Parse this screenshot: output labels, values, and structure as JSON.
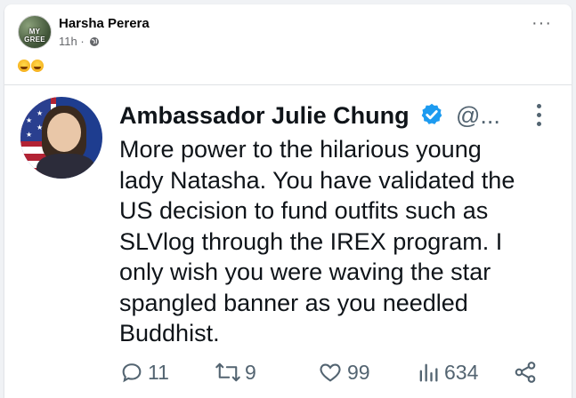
{
  "post": {
    "author": "Harsha Perera",
    "avatar_text": "MY GREE",
    "time": "11h ·",
    "reactions": [
      "rolling-on-floor-laughing",
      "rolling-on-floor-laughing"
    ]
  },
  "tweet": {
    "name": "Ambassador Julie Chung",
    "handle": "@...",
    "text": "More power to the hilarious young\nlady Natasha. You have validated the\nUS decision to fund outfits such as\nSLVlog through the IREX program. I\nonly wish you were waving the star\nspangled banner as you needled\nBuddhist.",
    "stats": {
      "replies": "11",
      "retweets": "9",
      "likes": "99",
      "views": "634"
    }
  },
  "colors": {
    "tweet_verified": "#1d9bf0",
    "tweet_icons": "#536471",
    "fb_secondary": "#65676b"
  }
}
